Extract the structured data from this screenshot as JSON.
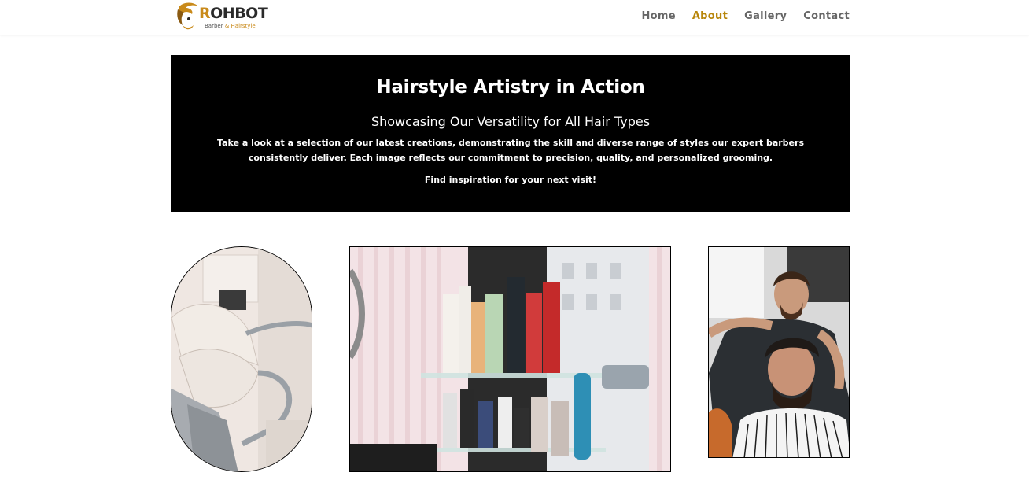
{
  "header": {
    "logo": {
      "word_first": "R",
      "word_rest": "OHBOT",
      "tagline_a": "Barber",
      "tagline_b": "& Hairstyle"
    },
    "nav": [
      {
        "label": "Home",
        "active": false
      },
      {
        "label": "About",
        "active": true
      },
      {
        "label": "Gallery",
        "active": false
      },
      {
        "label": "Contact",
        "active": false
      }
    ]
  },
  "hero": {
    "title": "Hairstyle Artistry in Action",
    "subtitle": "Showcasing Our Versatility for All Hair Types",
    "description": "Take a look at a selection of our latest creations, demonstrating the skill and diverse range of styles our expert barbers consistently deliver. Each image reflects our commitment to precision, quality, and personalized grooming.",
    "cta": "Find inspiration for your next visit!"
  },
  "gallery": {
    "images": [
      {
        "name": "salon-chair-photo"
      },
      {
        "name": "hair-products-shelf-photo"
      },
      {
        "name": "barber-cutting-hair-photo"
      }
    ]
  },
  "colors": {
    "accent": "#b8860b",
    "logo_accent": "#c98a1a",
    "nav_text": "#666666",
    "hero_bg": "#000000",
    "hero_text": "#ffffff"
  }
}
